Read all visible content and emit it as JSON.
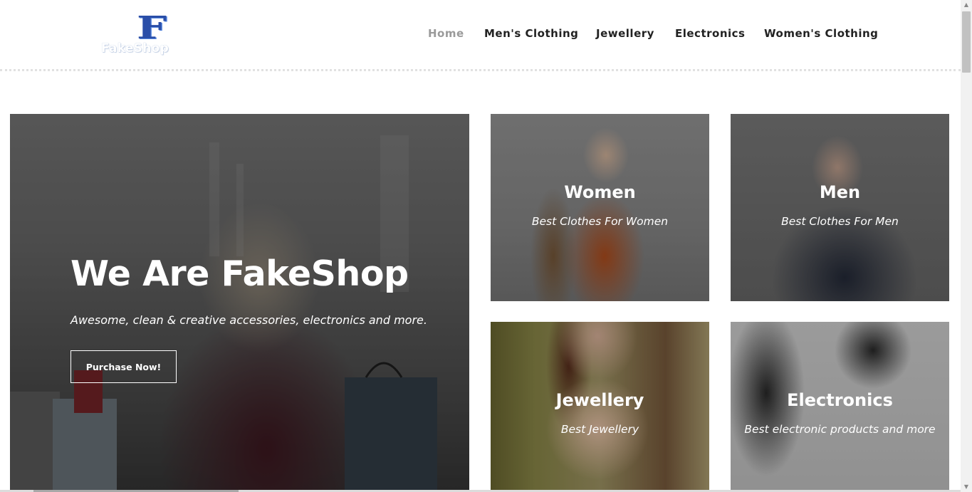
{
  "logo": {
    "mark": "F",
    "text": "FakeShop"
  },
  "nav": {
    "items": [
      {
        "label": "Home",
        "active": true
      },
      {
        "label": "Men's Clothing",
        "active": false
      },
      {
        "label": "Jewellery",
        "active": false
      },
      {
        "label": "Electronics",
        "active": false
      },
      {
        "label": "Women's Clothing",
        "active": false
      }
    ]
  },
  "hero": {
    "title": "We Are FakeShop",
    "subtitle": "Awesome, clean & creative accessories, electronics and more.",
    "button_label": "Purchase Now!"
  },
  "categories": [
    {
      "title": "Women",
      "subtitle": "Best Clothes For Women"
    },
    {
      "title": "Men",
      "subtitle": "Best Clothes For Men"
    },
    {
      "title": "Jewellery",
      "subtitle": "Best Jewellery"
    },
    {
      "title": "Electronics",
      "subtitle": "Best electronic products and more"
    }
  ],
  "colors": {
    "nav_active": "#9a9a9a",
    "nav_text": "#222222",
    "logo_blue": "#2a4ea8"
  }
}
